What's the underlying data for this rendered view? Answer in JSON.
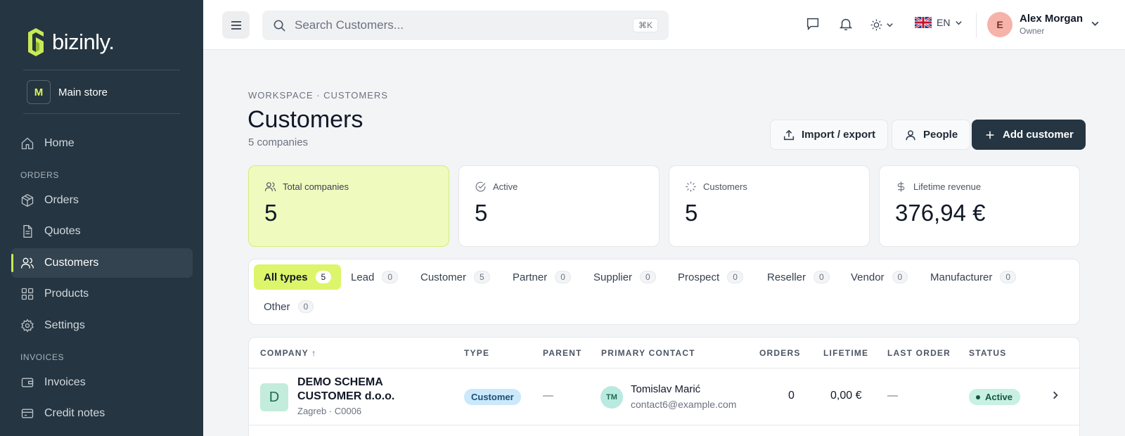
{
  "brand": {
    "name": "bizinly."
  },
  "store": {
    "initial": "M",
    "name": "Main store"
  },
  "sidebar": {
    "home": "Home",
    "section_orders": "ORDERS",
    "orders": "Orders",
    "quotes": "Quotes",
    "customers": "Customers",
    "products": "Products",
    "settings": "Settings",
    "section_invoices": "INVOICES",
    "invoices": "Invoices",
    "credit_notes": "Credit notes"
  },
  "topbar": {
    "search_placeholder": "Search Customers...",
    "search_shortcut": "⌘K",
    "language": "EN",
    "user_initial": "E",
    "user_name": "Alex Morgan",
    "user_role": "Owner"
  },
  "page": {
    "breadcrumb": "WORKSPACE · CUSTOMERS",
    "title": "Customers",
    "subtitle": "5 companies",
    "import_export": "Import / export",
    "people": "People",
    "add_customer": "Add customer"
  },
  "stats": [
    {
      "label": "Total companies",
      "value": "5",
      "icon": "users-icon"
    },
    {
      "label": "Active",
      "value": "5",
      "icon": "check-circle-icon"
    },
    {
      "label": "Customers",
      "value": "5",
      "icon": "loader-icon"
    },
    {
      "label": "Lifetime revenue",
      "value": "376,94 €",
      "icon": "dollar-icon"
    }
  ],
  "filters": [
    {
      "label": "All types",
      "count": "5"
    },
    {
      "label": "Lead",
      "count": "0"
    },
    {
      "label": "Customer",
      "count": "5"
    },
    {
      "label": "Partner",
      "count": "0"
    },
    {
      "label": "Supplier",
      "count": "0"
    },
    {
      "label": "Prospect",
      "count": "0"
    },
    {
      "label": "Reseller",
      "count": "0"
    },
    {
      "label": "Vendor",
      "count": "0"
    },
    {
      "label": "Manufacturer",
      "count": "0"
    },
    {
      "label": "Other",
      "count": "0"
    }
  ],
  "table": {
    "headers": {
      "company": "COMPANY ↑",
      "type": "TYPE",
      "parent": "PARENT",
      "primary_contact": "PRIMARY CONTACT",
      "orders": "ORDERS",
      "lifetime": "LIFETIME",
      "last_order": "LAST ORDER",
      "status": "STATUS"
    },
    "rows": [
      {
        "initial": "D",
        "company": "DEMO SCHEMA CUSTOMER d.o.o.",
        "meta": "Zagreb · C0006",
        "type": "Customer",
        "parent": "—",
        "contact_initials": "TM",
        "contact_name": "Tomislav Marić",
        "contact_email": "contact6@example.com",
        "orders": "0",
        "lifetime": "0,00 €",
        "last_order": "—",
        "status": "Active"
      }
    ]
  },
  "colors": {
    "sidebar_bg": "#253541",
    "accent_lime": "#dcf56b",
    "primary_button": "#253541"
  }
}
